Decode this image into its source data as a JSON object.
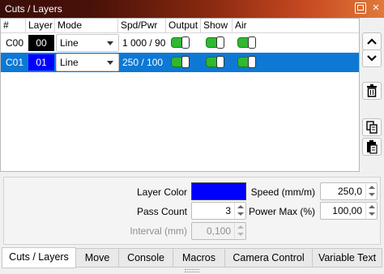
{
  "window": {
    "title": "Cuts / Layers"
  },
  "table": {
    "headers": [
      "#",
      "Layer",
      "Mode",
      "Spd/Pwr",
      "Output",
      "Show",
      "Air"
    ],
    "rows": [
      {
        "code": "C00",
        "layer": "00",
        "layer_color": "#000000",
        "mode": "Line",
        "spd_pwr": "1 000 / 90",
        "output": true,
        "show": true,
        "air": true,
        "selected": false
      },
      {
        "code": "C01",
        "layer": "01",
        "layer_color": "#0000ff",
        "mode": "Line",
        "spd_pwr": "250 / 100",
        "output": true,
        "show": true,
        "air": true,
        "selected": true
      }
    ]
  },
  "side_buttons": [
    "move-up-icon",
    "move-down-icon",
    "delete-icon",
    "copy-icon",
    "paste-icon"
  ],
  "properties": {
    "layer_color_label": "Layer Color",
    "layer_color": "#0000ff",
    "pass_count_label": "Pass Count",
    "pass_count": "3",
    "interval_label": "Interval (mm)",
    "interval": "0,100",
    "speed_label": "Speed (mm/m)",
    "speed": "250,0",
    "power_max_label": "Power Max (%)",
    "power_max": "100,00"
  },
  "tabs": [
    "Cuts / Layers",
    "Move",
    "Console",
    "Macros",
    "Camera Control",
    "Variable Text"
  ],
  "active_tab": "Cuts / Layers",
  "colors": {
    "selection": "#0e78d5",
    "toggle_on": "#2fb830"
  }
}
